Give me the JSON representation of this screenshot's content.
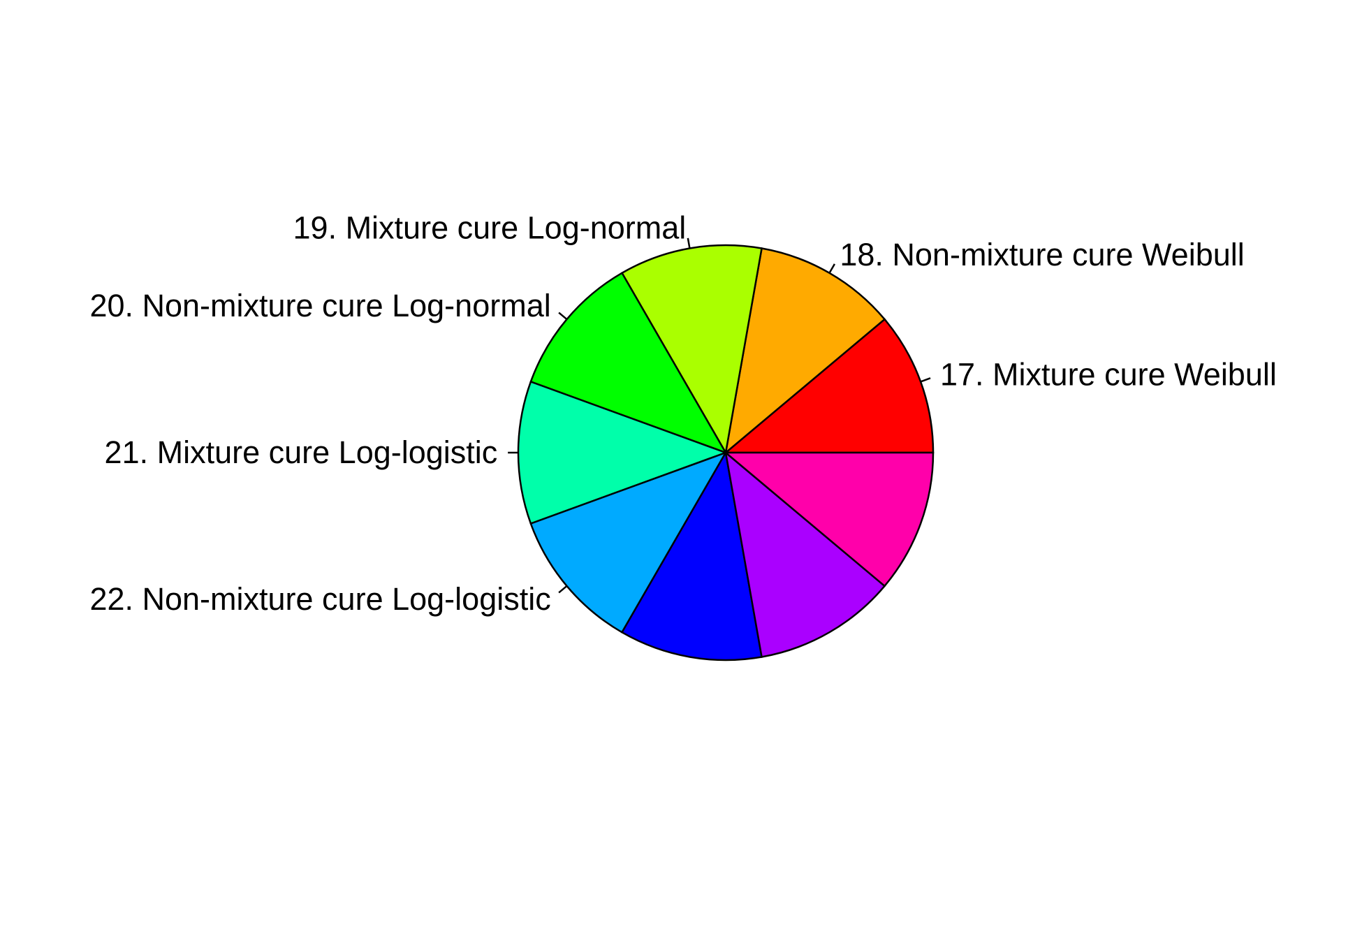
{
  "chart_data": {
    "type": "pie",
    "title": "",
    "start_angle_deg": 0,
    "direction": "counterclockwise",
    "slices": [
      {
        "label": "17. Mixture cure Weibull",
        "value": 1,
        "color": "#FF0000"
      },
      {
        "label": "18. Non-mixture cure Weibull",
        "value": 1,
        "color": "#FFAA00"
      },
      {
        "label": "19. Mixture cure Log-normal",
        "value": 1,
        "color": "#AAFF00"
      },
      {
        "label": "20. Non-mixture cure Log-normal",
        "value": 1,
        "color": "#00FF00"
      },
      {
        "label": "21. Mixture cure Log-logistic",
        "value": 1,
        "color": "#00FFAA"
      },
      {
        "label": "22. Non-mixture cure Log-logistic",
        "value": 1,
        "color": "#00AAFF"
      },
      {
        "label": "",
        "value": 1,
        "color": "#0000FF"
      },
      {
        "label": "",
        "value": 1,
        "color": "#AA00FF"
      },
      {
        "label": "",
        "value": 1,
        "color": "#FF00AA"
      }
    ]
  }
}
